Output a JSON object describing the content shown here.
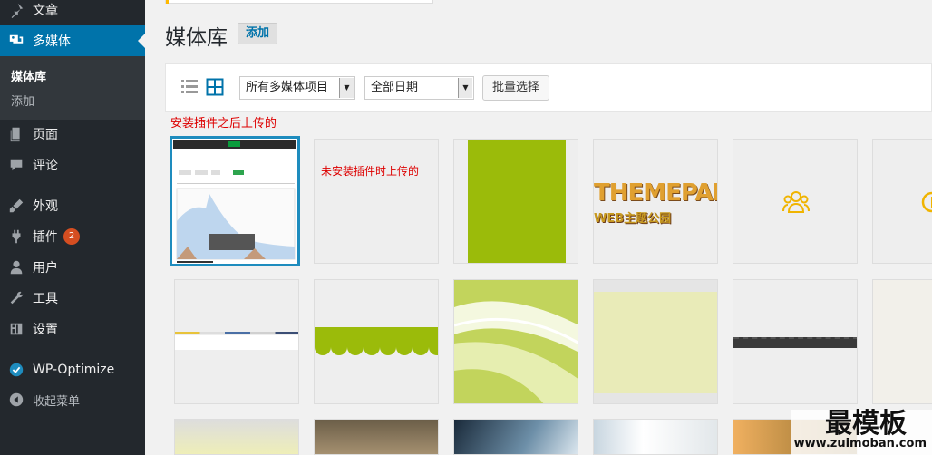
{
  "sidebar": {
    "items": [
      {
        "label": "文章",
        "icon": "pin-icon"
      },
      {
        "label": "多媒体",
        "icon": "media-icon"
      },
      {
        "label": "页面",
        "icon": "pages-icon"
      },
      {
        "label": "评论",
        "icon": "comments-icon"
      },
      {
        "label": "外观",
        "icon": "appearance-icon"
      },
      {
        "label": "插件",
        "icon": "plugins-icon",
        "badge": "2"
      },
      {
        "label": "用户",
        "icon": "users-icon"
      },
      {
        "label": "工具",
        "icon": "tools-icon"
      },
      {
        "label": "设置",
        "icon": "settings-icon"
      },
      {
        "label": "WP-Optimize",
        "icon": "wp-optimize-icon"
      },
      {
        "label": "收起菜单",
        "icon": "collapse-icon"
      }
    ],
    "submenu": {
      "library": "媒体库",
      "add": "添加"
    }
  },
  "page": {
    "title": "媒体库",
    "add_button": "添加"
  },
  "toolbar": {
    "type_filter": "所有多媒体项目",
    "date_filter": "全部日期",
    "bulk_select": "批量选择"
  },
  "notes": {
    "after_plugin": "安装插件之后上传的",
    "before_plugin": "未安装插件时上传的"
  },
  "tiles": {
    "themepark_line1": "THEMEPARK",
    "themepark_line2": "WEB主题公园"
  },
  "watermark": {
    "title": "最模板",
    "url": "www.zuimoban.com"
  },
  "colors": {
    "accent": "#0073aa",
    "sidebar": "#23282d",
    "badge": "#d54e21",
    "green": "#9bbb0a"
  }
}
